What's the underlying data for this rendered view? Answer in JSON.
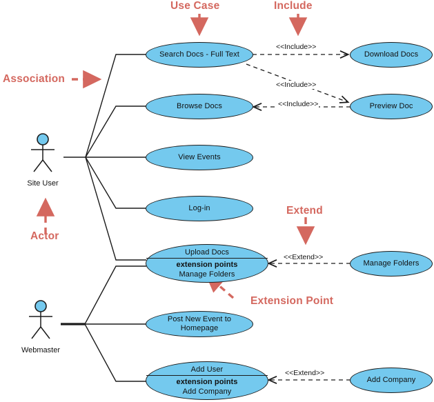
{
  "diagram": {
    "type": "uml-use-case-diagram",
    "colors": {
      "use_case_fill": "#74C9EE",
      "stroke": "#1b1b1b",
      "annotation_red": "#D4685F",
      "background": "#ffffff"
    }
  },
  "actors": [
    {
      "id": "site-user",
      "name": "Site User"
    },
    {
      "id": "webmaster",
      "name": "Webmaster"
    }
  ],
  "use_cases": [
    {
      "id": "search-docs",
      "title": "Search Docs - Full Text"
    },
    {
      "id": "browse-docs",
      "title": "Browse Docs"
    },
    {
      "id": "view-events",
      "title": "View Events"
    },
    {
      "id": "log-in",
      "title": "Log-in"
    },
    {
      "id": "upload-docs",
      "title": "Upload Docs",
      "extension_points_header": "extension points",
      "extension_points": "Manage Folders"
    },
    {
      "id": "post-new-event",
      "title": "Post New Event to Homepage",
      "line1": "Post New Event to",
      "line2": "Homepage"
    },
    {
      "id": "add-user",
      "title": "Add User",
      "extension_points_header": "extension points",
      "extension_points": "Add Company"
    },
    {
      "id": "download-docs",
      "title": "Download Docs"
    },
    {
      "id": "preview-doc",
      "title": "Preview Doc"
    },
    {
      "id": "manage-folders",
      "title": "Manage Folders"
    },
    {
      "id": "add-company",
      "title": "Add Company"
    }
  ],
  "relationships": [
    {
      "id": "rel-search-download",
      "label": "<<Include>>",
      "from": "search-docs",
      "to": "download-docs"
    },
    {
      "id": "rel-search-preview",
      "label": "<<Include>>",
      "from": "search-docs",
      "to": "preview-doc"
    },
    {
      "id": "rel-preview-browse",
      "label": "<<Include>>",
      "from": "preview-doc",
      "to": "browse-docs"
    },
    {
      "id": "rel-managefolders-upload",
      "label": "<<Extend>>",
      "from": "manage-folders",
      "to": "upload-docs"
    },
    {
      "id": "rel-addcompany-adduser",
      "label": "<<Extend>>",
      "from": "add-company",
      "to": "add-user"
    }
  ],
  "annotations": [
    {
      "id": "annot-use-case",
      "text": "Use Case"
    },
    {
      "id": "annot-include",
      "text": "Include"
    },
    {
      "id": "annot-association",
      "text": "Association"
    },
    {
      "id": "annot-actor",
      "text": "Actor"
    },
    {
      "id": "annot-extend",
      "text": "Extend"
    },
    {
      "id": "annot-extension-point",
      "text": "Extension Point"
    }
  ]
}
